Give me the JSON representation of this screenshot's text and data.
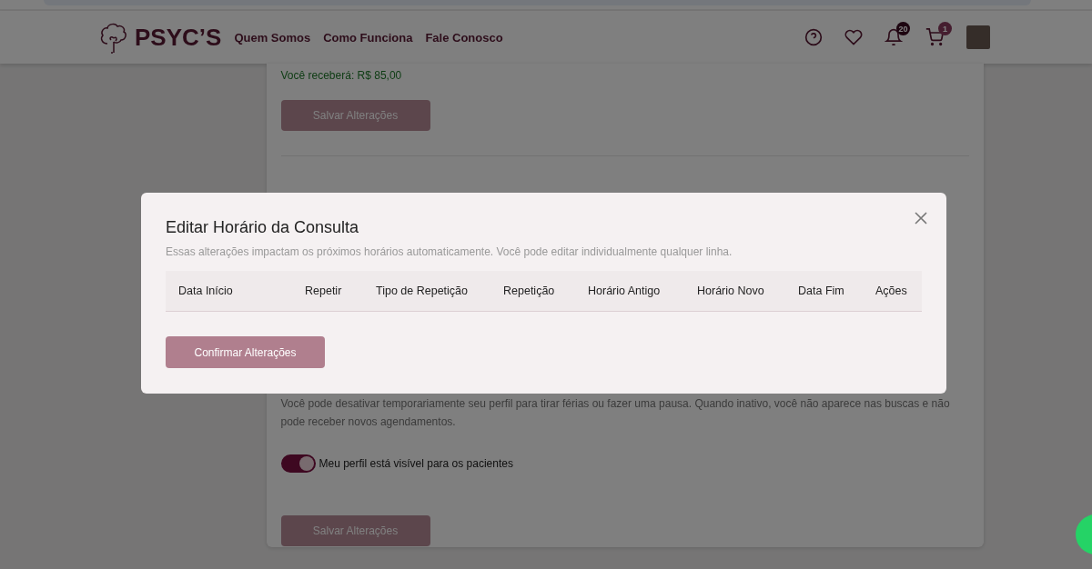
{
  "header": {
    "logo": "PSYC’S",
    "nav": [
      "Quem Somos",
      "Como Funciona",
      "Fale Conosco"
    ],
    "notifications_count": "20",
    "cart_count": "1"
  },
  "card": {
    "payout": "Você receberá: R$ 85,00",
    "save_button": "Salvar Alterações",
    "availability_text": "Você pode desativar temporariamente seu perfil para tirar férias ou fazer uma pausa. Quando inativo, você não aparece nas buscas e não pode receber novos agendamentos.",
    "visibility_toggle": {
      "label": "Meu perfil está visível para os pacientes",
      "on": true
    },
    "save_button_2": "Salvar Alterações"
  },
  "modal": {
    "title": "Editar Horário da Consulta",
    "description": "Essas alterações impactam os próximos horários automaticamente. Você pode editar individualmente qualquer linha.",
    "table": {
      "columns": [
        "Data Início",
        "Repetir",
        "Tipo de Repetição",
        "Repetição",
        "Horário Antigo",
        "Horário Novo",
        "Data Fim",
        "Ações"
      ]
    },
    "confirm_button": "Confirmar Alterações"
  }
}
